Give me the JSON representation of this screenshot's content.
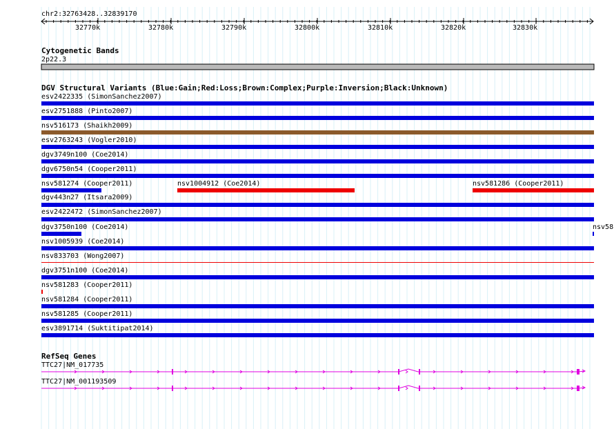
{
  "ruler": {
    "title": "chr2:32763428..32839170",
    "ticks": [
      "32770k",
      "32780k",
      "32790k",
      "32800k",
      "32810k",
      "32820k",
      "32830k"
    ]
  },
  "cytoband": {
    "header": "Cytogenetic Bands",
    "band_label": "2p22.3"
  },
  "dgv": {
    "header": "DGV Structural Variants (Blue:Gain;Red:Loss;Brown:Complex;Purple:Inversion;Black:Unknown)",
    "colors": {
      "gain": "#0000dd",
      "loss": "#ee0000",
      "complex": "#8b5a2b",
      "inversion": "#800080",
      "unknown": "#000000"
    },
    "rows": [
      {
        "label": "esv2422335 (SimonSanchez2007)",
        "color": "#0000dd"
      },
      {
        "label": "esv2751888 (Pinto2007)",
        "color": "#0000dd"
      },
      {
        "label": "nsv516173 (Shaikh2009)",
        "color": "#8b5a2b"
      },
      {
        "label": "esv2763243 (Vogler2010)",
        "color": "#0000dd"
      },
      {
        "label": "dgv3749n100 (Coe2014)",
        "color": "#0000dd"
      },
      {
        "label": "dgv6750n54 (Cooper2011)",
        "color": "#0000dd"
      },
      {
        "label": "nsv581274 (Cooper2011)",
        "color": "#0000dd"
      },
      {
        "label": "nsv1004912 (Coe2014)",
        "color": "#ee0000"
      },
      {
        "label": "nsv581286 (Cooper2011)",
        "color": "#ee0000"
      },
      {
        "label": "dgv443n27 (Itsara2009)",
        "color": "#0000dd"
      },
      {
        "label": "esv2422472 (SimonSanchez2007)",
        "color": "#0000dd"
      },
      {
        "label": "dgv3750n100 (Coe2014)",
        "color": "#0000dd"
      },
      {
        "label": "nsv58",
        "color": "#0000dd"
      },
      {
        "label": "nsv1005939 (Coe2014)",
        "color": "#0000dd"
      },
      {
        "label": "nsv833703 (Wong2007)",
        "color": "#ee0000"
      },
      {
        "label": "dgv3751n100 (Coe2014)",
        "color": "#0000dd"
      },
      {
        "label": "nsv581283 (Cooper2011)",
        "color": "#ee0000"
      },
      {
        "label": "nsv581284 (Cooper2011)",
        "color": "#0000dd"
      },
      {
        "label": "nsv581285 (Cooper2011)",
        "color": "#0000dd"
      },
      {
        "label": "esv3891714 (Suktitipat2014)",
        "color": "#0000dd"
      }
    ]
  },
  "refseq": {
    "header": "RefSeq Genes",
    "color": "#e000e0",
    "transcripts": [
      {
        "label": "TTC27|NM_017735"
      },
      {
        "label": "TTC27|NM_001193509"
      }
    ]
  }
}
